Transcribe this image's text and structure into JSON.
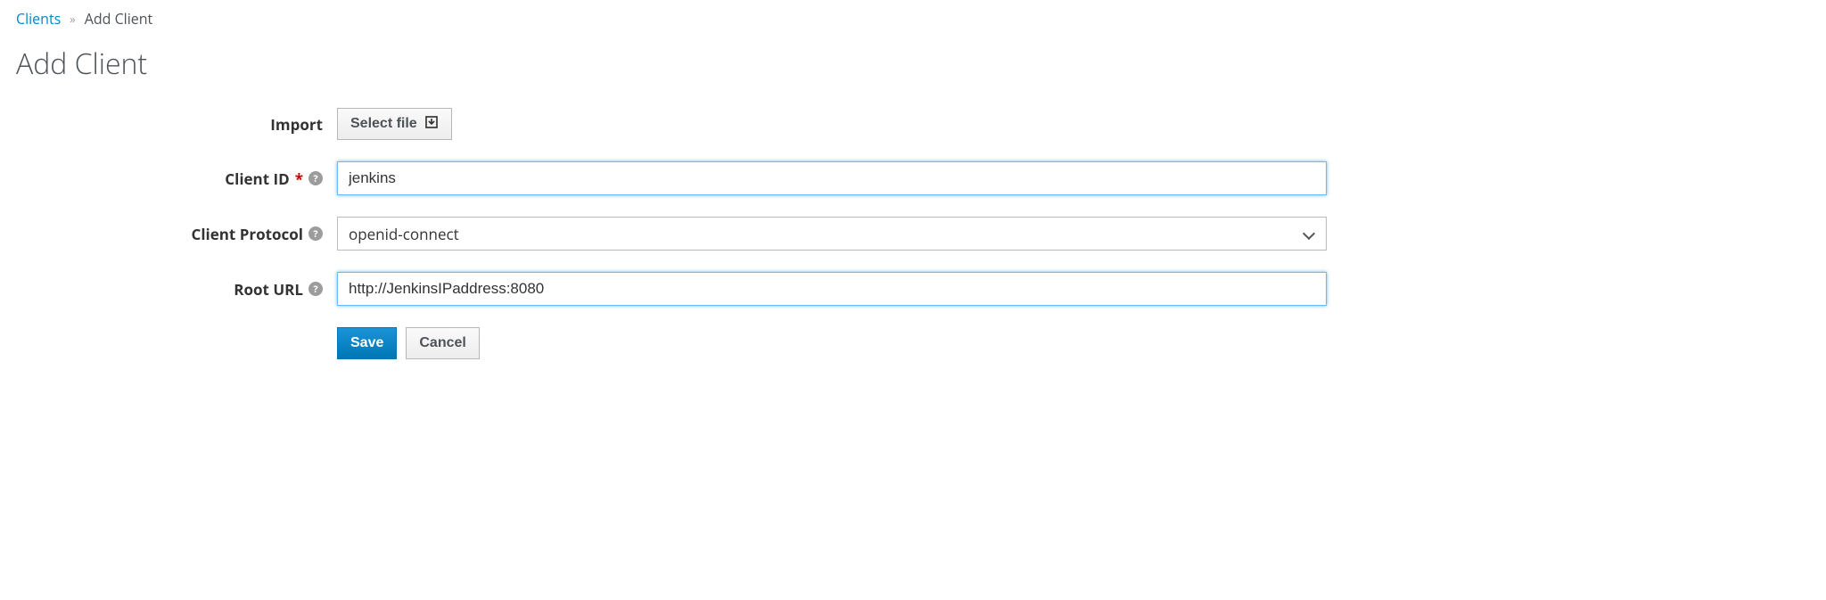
{
  "breadcrumb": {
    "parent": "Clients",
    "current": "Add Client"
  },
  "page_title": "Add Client",
  "form": {
    "import_label": "Import",
    "select_file_label": "Select file",
    "client_id": {
      "label": "Client ID",
      "required_marker": "*",
      "value": "jenkins"
    },
    "client_protocol": {
      "label": "Client Protocol",
      "selected": "openid-connect"
    },
    "root_url": {
      "label": "Root URL",
      "value": "http://JenkinsIPaddress:8080"
    }
  },
  "buttons": {
    "save": "Save",
    "cancel": "Cancel"
  }
}
